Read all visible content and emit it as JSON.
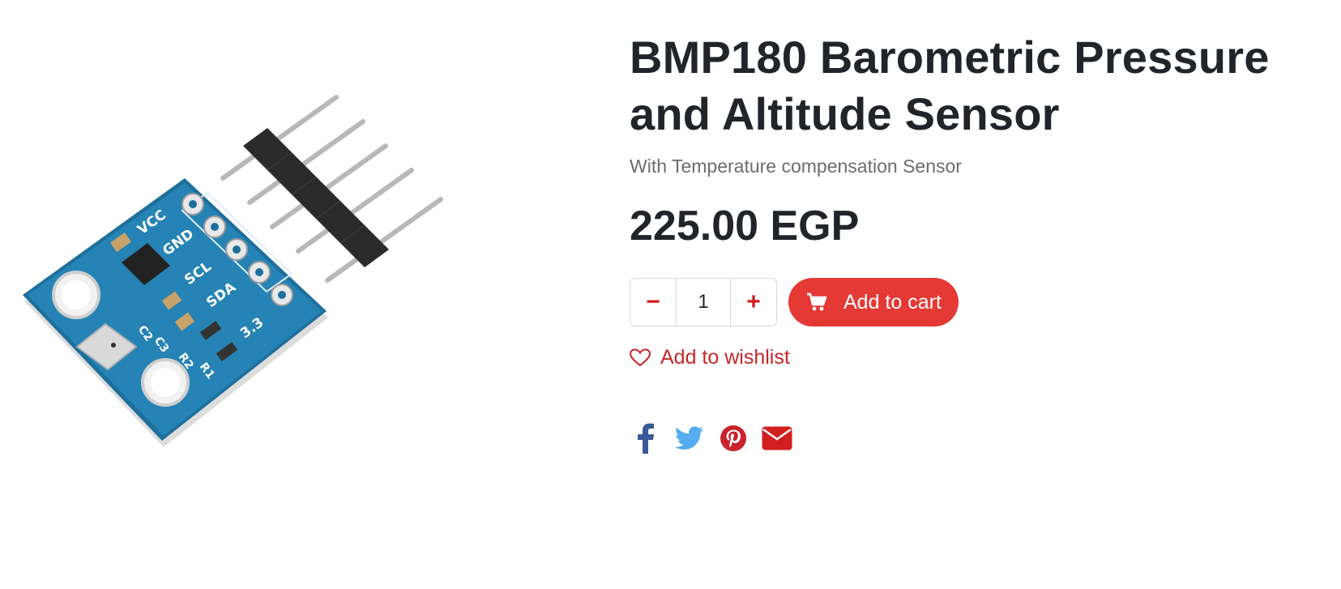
{
  "product": {
    "title": "BMP180 Barometric Pressure and Altitude Sensor",
    "subtitle": "With Temperature compensation Sensor",
    "price": "225.00 EGP"
  },
  "cart": {
    "quantity": "1",
    "decrement_label": "−",
    "increment_label": "+",
    "add_label": "Add to cart",
    "add_icon": "shopping-cart-icon"
  },
  "wishlist": {
    "label": "Add to wishlist",
    "icon": "heart-outline-icon"
  },
  "share": {
    "items": [
      {
        "name": "facebook",
        "icon": "facebook-icon",
        "color": "#3b5998"
      },
      {
        "name": "twitter",
        "icon": "twitter-icon",
        "color": "#55acee"
      },
      {
        "name": "pinterest",
        "icon": "pinterest-icon",
        "color": "#c8232c"
      },
      {
        "name": "email",
        "icon": "envelope-icon",
        "color": "#d11f1f"
      }
    ]
  },
  "theme": {
    "accent": "#e53935",
    "text": "#212529",
    "muted": "#6c6c6c"
  },
  "image": {
    "board_labels": [
      "VCC",
      "GND",
      "SCL",
      "SDA",
      "3.3",
      "C2",
      "C3",
      "R2",
      "R1"
    ]
  }
}
